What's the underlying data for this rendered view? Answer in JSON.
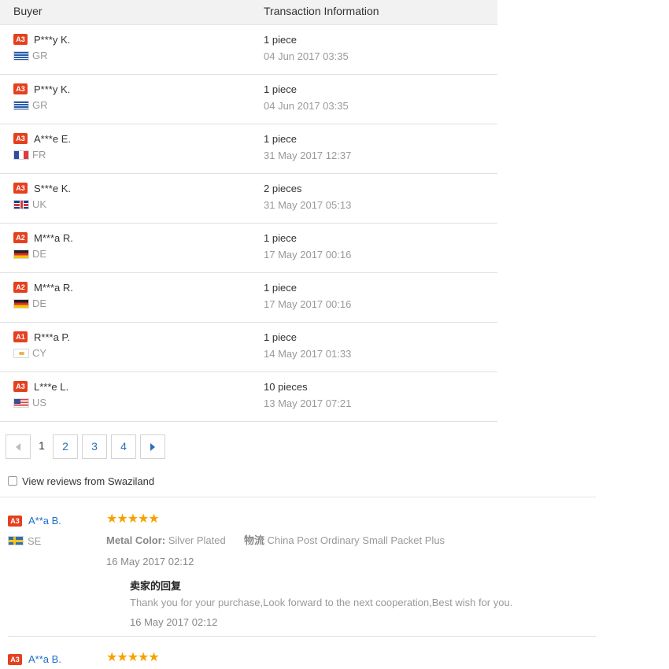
{
  "table": {
    "header": {
      "buyer": "Buyer",
      "transaction": "Transaction Information"
    },
    "rows": [
      {
        "level": "A3",
        "buyer": "P***y K.",
        "flag": "flag-gr",
        "country": "GR",
        "quantity": "1 piece",
        "date": "04 Jun 2017 03:35"
      },
      {
        "level": "A3",
        "buyer": "P***y K.",
        "flag": "flag-gr",
        "country": "GR",
        "quantity": "1 piece",
        "date": "04 Jun 2017 03:35"
      },
      {
        "level": "A3",
        "buyer": "A***e E.",
        "flag": "flag-fr",
        "country": "FR",
        "quantity": "1 piece",
        "date": "31 May 2017 12:37"
      },
      {
        "level": "A3",
        "buyer": "S***e K.",
        "flag": "flag-uk",
        "country": "UK",
        "quantity": "2 pieces",
        "date": "31 May 2017 05:13"
      },
      {
        "level": "A2",
        "buyer": "M***a R.",
        "flag": "flag-de",
        "country": "DE",
        "quantity": "1 piece",
        "date": "17 May 2017 00:16"
      },
      {
        "level": "A2",
        "buyer": "M***a R.",
        "flag": "flag-de",
        "country": "DE",
        "quantity": "1 piece",
        "date": "17 May 2017 00:16"
      },
      {
        "level": "A1",
        "buyer": "R***a P.",
        "flag": "flag-cy",
        "country": "CY",
        "quantity": "1 piece",
        "date": "14 May 2017 01:33"
      },
      {
        "level": "A3",
        "buyer": "L***e L.",
        "flag": "flag-us",
        "country": "US",
        "quantity": "10 pieces",
        "date": "13 May 2017 07:21"
      }
    ]
  },
  "pagination": {
    "prev_icon": "chevron-left-icon",
    "next_icon": "chevron-right-icon",
    "current": "1",
    "pages": [
      "2",
      "3",
      "4"
    ]
  },
  "reviews_filter": {
    "label": "View reviews from Swaziland",
    "checked": false
  },
  "reviews": [
    {
      "level": "A3",
      "name": "A**a B.",
      "country": "SE",
      "flag": "flag-se",
      "stars": "★★★★★",
      "rating": 5,
      "color_label": "Metal Color:",
      "color_value": "Silver Plated",
      "shipping_label": "物流",
      "shipping_value": "China Post Ordinary Small Packet Plus",
      "date": "16 May 2017 02:12",
      "reply_title": "卖家的回复",
      "reply_text": "Thank you for your purchase,Look forward to the next cooperation,Best wish for you.",
      "reply_date": "16 May 2017 02:12"
    },
    {
      "level": "A3",
      "name": "A**a B.",
      "stars": "★★★★★",
      "rating": 5
    }
  ],
  "colors": {
    "accent_red": "#e5401f",
    "link_blue": "#1f6fc5",
    "star": "#f5a200"
  }
}
